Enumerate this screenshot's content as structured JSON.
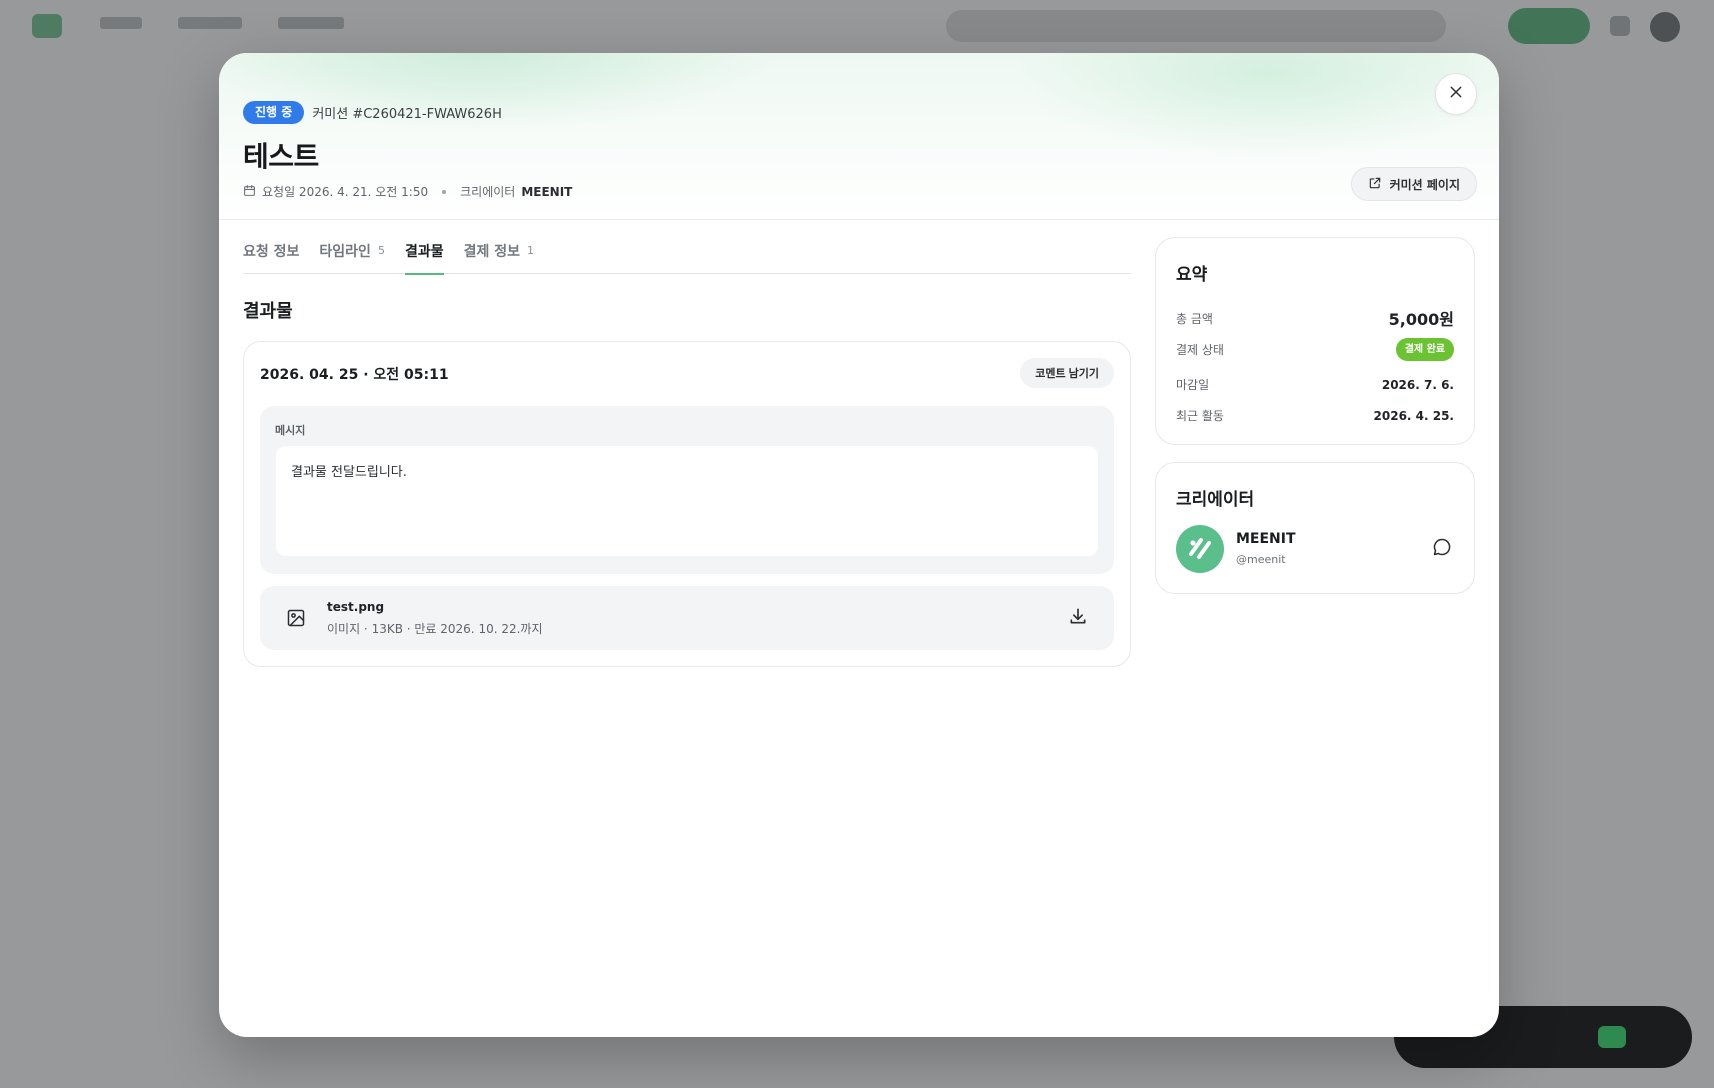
{
  "header": {
    "status_badge": "진행 중",
    "commission_id": "커미션 #C260421-FWAW626H",
    "title": "테스트",
    "requested_label": "요청일 2026. 4. 21. 오전 1:50",
    "creator_label": "크리에이터",
    "creator_name": "MEENIT",
    "commission_page_button": "커미션 페이지"
  },
  "tabs": [
    {
      "label": "요청 정보",
      "count": ""
    },
    {
      "label": "타임라인",
      "count": "5"
    },
    {
      "label": "결과물",
      "count": ""
    },
    {
      "label": "결제 정보",
      "count": "1"
    }
  ],
  "active_tab": "결과물",
  "result": {
    "section_title": "결과물",
    "date": "2026. 04. 25 · 오전 05:11",
    "comment_button": "코멘트 남기기",
    "message_label": "메시지",
    "message": "결과물 전달드립니다.",
    "file": {
      "name": "test.png",
      "meta": "이미지 · 13KB · 만료 2026. 10. 22.까지"
    }
  },
  "summary": {
    "title": "요약",
    "rows": [
      {
        "label": "총 금액",
        "value": "5,000원"
      },
      {
        "label": "결제 상태",
        "value": "결제 완료"
      },
      {
        "label": "마감일",
        "value": "2026. 7. 6."
      },
      {
        "label": "최근 활동",
        "value": "2026. 4. 25."
      }
    ]
  },
  "creator": {
    "title": "크리에이터",
    "name": "MEENIT",
    "handle": "@meenit"
  },
  "colors": {
    "accent_green": "#55b982",
    "status_blue": "#2f7bea",
    "paid_green": "#6bc233"
  },
  "icons": {
    "close": "close-icon",
    "calendar": "calendar-icon",
    "external_link": "external-link-icon",
    "image": "image-icon",
    "download": "download-icon",
    "chat": "chat-icon"
  }
}
